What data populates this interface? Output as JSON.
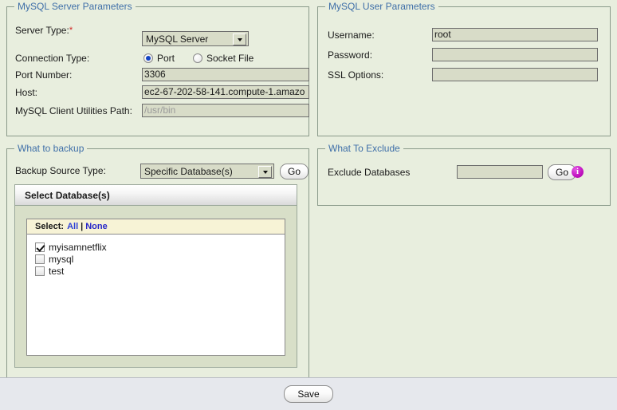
{
  "server_panel": {
    "legend": "MySQL Server Parameters",
    "server_type": {
      "label": "Server Type:",
      "required_mark": "*",
      "value": "MySQL Server"
    },
    "connection_type": {
      "label": "Connection Type:",
      "options": [
        {
          "label": "Port",
          "selected": true
        },
        {
          "label": "Socket File",
          "selected": false
        }
      ]
    },
    "port_number": {
      "label": "Port Number:",
      "value": "3306"
    },
    "host": {
      "label": "Host:",
      "value": "ec2-67-202-58-141.compute-1.amazo"
    },
    "client_path": {
      "label": "MySQL Client Utilities Path:",
      "value": "",
      "placeholder": "/usr/bin"
    }
  },
  "user_panel": {
    "legend": "MySQL User Parameters",
    "username": {
      "label": "Username:",
      "value": "root"
    },
    "password": {
      "label": "Password:",
      "value": ""
    },
    "ssl_options": {
      "label": "SSL Options:",
      "value": ""
    }
  },
  "backup_panel": {
    "legend": "What to backup",
    "source_type": {
      "label": "Backup Source Type:",
      "value": "Specific Database(s)"
    },
    "go_label": "Go",
    "db_card": {
      "header": "Select Database(s)",
      "select_label": "Select:",
      "select_all": "All",
      "separator": "|",
      "select_none": "None",
      "databases": [
        {
          "name": "myisamnetflix",
          "checked": true
        },
        {
          "name": "mysql",
          "checked": false
        },
        {
          "name": "test",
          "checked": false
        }
      ]
    }
  },
  "exclude_panel": {
    "legend": "What To Exclude",
    "exclude_label": "Exclude Databases",
    "exclude_value": "",
    "go_label": "Go",
    "info_icon": "info-icon",
    "info_glyph": "i"
  },
  "footer": {
    "save_label": "Save"
  },
  "colors": {
    "page_bg": "#e8eede",
    "legend_text": "#3f6fa8",
    "field_bg": "#d8dcc8",
    "required": "#d02020",
    "link": "#2b3fd6",
    "info_icon": "#c316c3",
    "footer_bg": "#e6e8ed"
  }
}
